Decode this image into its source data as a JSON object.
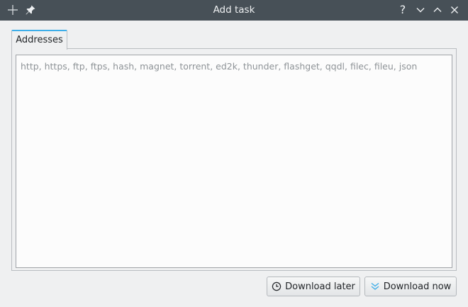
{
  "window": {
    "title": "Add task",
    "controls": [
      "help",
      "minimize",
      "maximize",
      "close"
    ],
    "help_label": "?"
  },
  "tabs": [
    {
      "label": "Addresses",
      "active": true
    }
  ],
  "addresses": {
    "value": "",
    "placeholder": "http, https, ftp, ftps, hash, magnet, torrent, ed2k, thunder, flashget, qqdl, filec, fileu, json"
  },
  "buttons": {
    "download_later": "Download later",
    "download_now": "Download now"
  },
  "colors": {
    "titlebar": "#475057",
    "accent": "#3daee9",
    "window_bg": "#eff0f1"
  }
}
